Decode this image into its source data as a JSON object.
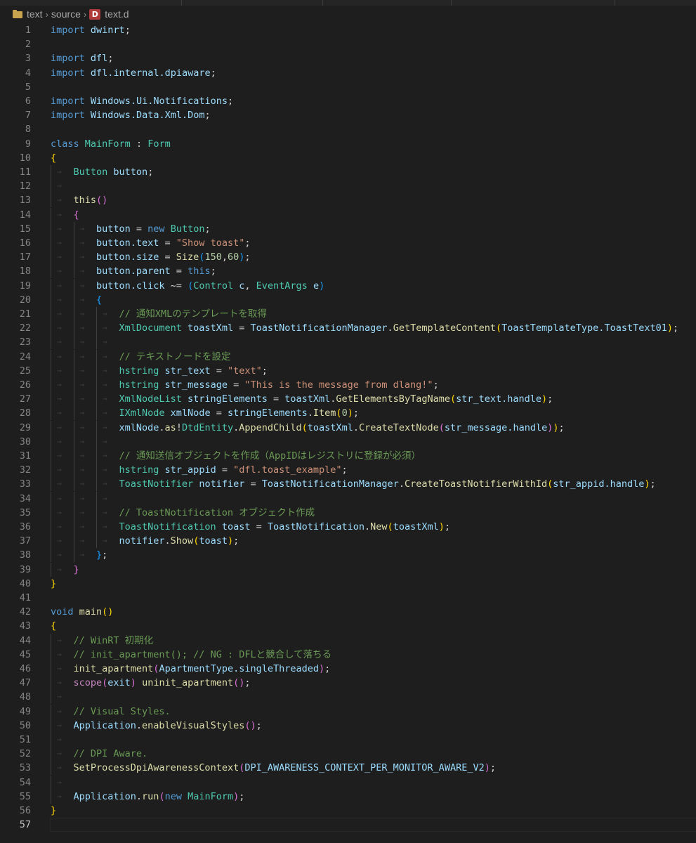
{
  "breadcrumb": {
    "items": [
      "text",
      "source",
      "text.d"
    ],
    "file_icon_letter": "D"
  },
  "editor": {
    "language": "d",
    "active_line": 57,
    "colors": {
      "background": "#1e1e1e",
      "keyword": "#569cd6",
      "control": "#c586c0",
      "type": "#4ec9b0",
      "identifier": "#9cdcfe",
      "function": "#dcdcaa",
      "string": "#ce9178",
      "number": "#b5cea8",
      "comment": "#6a9955",
      "bracket_1": "#ffd700",
      "bracket_2": "#da70d6",
      "bracket_3": "#179fff"
    },
    "lines": [
      {
        "n": "1",
        "indent": 0,
        "t": [
          [
            "kw",
            "import"
          ],
          [
            "pn",
            " "
          ],
          [
            "id",
            "dwinrt"
          ],
          [
            "pn",
            ";"
          ]
        ]
      },
      {
        "n": "2",
        "indent": 0,
        "t": []
      },
      {
        "n": "3",
        "indent": 0,
        "t": [
          [
            "kw",
            "import"
          ],
          [
            "pn",
            " "
          ],
          [
            "id",
            "dfl"
          ],
          [
            "pn",
            ";"
          ]
        ]
      },
      {
        "n": "4",
        "indent": 0,
        "t": [
          [
            "kw",
            "import"
          ],
          [
            "pn",
            " "
          ],
          [
            "id",
            "dfl.internal.dpiaware"
          ],
          [
            "pn",
            ";"
          ]
        ]
      },
      {
        "n": "5",
        "indent": 0,
        "t": []
      },
      {
        "n": "6",
        "indent": 0,
        "t": [
          [
            "kw",
            "import"
          ],
          [
            "pn",
            " "
          ],
          [
            "id",
            "Windows.Ui.Notifications"
          ],
          [
            "pn",
            ";"
          ]
        ]
      },
      {
        "n": "7",
        "indent": 0,
        "t": [
          [
            "kw",
            "import"
          ],
          [
            "pn",
            " "
          ],
          [
            "id",
            "Windows.Data.Xml.Dom"
          ],
          [
            "pn",
            ";"
          ]
        ]
      },
      {
        "n": "8",
        "indent": 0,
        "t": []
      },
      {
        "n": "9",
        "indent": 0,
        "t": [
          [
            "kw",
            "class"
          ],
          [
            "pn",
            " "
          ],
          [
            "ty",
            "MainForm"
          ],
          [
            "pn",
            " : "
          ],
          [
            "ty",
            "Form"
          ]
        ]
      },
      {
        "n": "10",
        "indent": 0,
        "t": [
          [
            "b1",
            "{"
          ]
        ]
      },
      {
        "n": "11",
        "indent": 1,
        "t": [
          [
            "ty",
            "Button"
          ],
          [
            "pn",
            " "
          ],
          [
            "id",
            "button"
          ],
          [
            "pn",
            ";"
          ]
        ]
      },
      {
        "n": "12",
        "indent": 1,
        "t": []
      },
      {
        "n": "13",
        "indent": 1,
        "t": [
          [
            "fn",
            "this"
          ],
          [
            "b2",
            "()"
          ]
        ]
      },
      {
        "n": "14",
        "indent": 1,
        "t": [
          [
            "b2",
            "{"
          ]
        ]
      },
      {
        "n": "15",
        "indent": 2,
        "t": [
          [
            "id",
            "button"
          ],
          [
            "pn",
            " = "
          ],
          [
            "kw",
            "new"
          ],
          [
            "pn",
            " "
          ],
          [
            "ty",
            "Button"
          ],
          [
            "pn",
            ";"
          ]
        ]
      },
      {
        "n": "16",
        "indent": 2,
        "t": [
          [
            "id",
            "button.text"
          ],
          [
            "pn",
            " = "
          ],
          [
            "st",
            "\"Show toast\""
          ],
          [
            "pn",
            ";"
          ]
        ]
      },
      {
        "n": "17",
        "indent": 2,
        "t": [
          [
            "id",
            "button.size"
          ],
          [
            "pn",
            " = "
          ],
          [
            "fn",
            "Size"
          ],
          [
            "b3",
            "("
          ],
          [
            "nm",
            "150"
          ],
          [
            "pn",
            ","
          ],
          [
            "nm",
            "60"
          ],
          [
            "b3",
            ")"
          ],
          [
            "pn",
            ";"
          ]
        ]
      },
      {
        "n": "18",
        "indent": 2,
        "t": [
          [
            "id",
            "button.parent"
          ],
          [
            "pn",
            " = "
          ],
          [
            "kw",
            "this"
          ],
          [
            "pn",
            ";"
          ]
        ]
      },
      {
        "n": "19",
        "indent": 2,
        "t": [
          [
            "id",
            "button.click"
          ],
          [
            "pn",
            " ~= "
          ],
          [
            "b3",
            "("
          ],
          [
            "ty",
            "Control"
          ],
          [
            "pn",
            " "
          ],
          [
            "id",
            "c"
          ],
          [
            "pn",
            ", "
          ],
          [
            "ty",
            "EventArgs"
          ],
          [
            "pn",
            " "
          ],
          [
            "id",
            "e"
          ],
          [
            "b3",
            ")"
          ]
        ]
      },
      {
        "n": "20",
        "indent": 2,
        "t": [
          [
            "b3",
            "{"
          ]
        ]
      },
      {
        "n": "21",
        "indent": 3,
        "t": [
          [
            "cm",
            "// 通知XMLのテンプレートを取得"
          ]
        ]
      },
      {
        "n": "22",
        "indent": 3,
        "t": [
          [
            "ty",
            "XmlDocument"
          ],
          [
            "pn",
            " "
          ],
          [
            "id",
            "toastXml"
          ],
          [
            "pn",
            " = "
          ],
          [
            "id",
            "ToastNotificationManager"
          ],
          [
            "pn",
            "."
          ],
          [
            "fn",
            "GetTemplateContent"
          ],
          [
            "b1",
            "("
          ],
          [
            "id",
            "ToastTemplateType.ToastText01"
          ],
          [
            "b1",
            ")"
          ],
          [
            "pn",
            ";"
          ]
        ]
      },
      {
        "n": "23",
        "indent": 3,
        "t": []
      },
      {
        "n": "24",
        "indent": 3,
        "t": [
          [
            "cm",
            "// テキストノードを設定"
          ]
        ]
      },
      {
        "n": "25",
        "indent": 3,
        "t": [
          [
            "ty",
            "hstring"
          ],
          [
            "pn",
            " "
          ],
          [
            "id",
            "str_text"
          ],
          [
            "pn",
            " = "
          ],
          [
            "st",
            "\"text\""
          ],
          [
            "pn",
            ";"
          ]
        ]
      },
      {
        "n": "26",
        "indent": 3,
        "t": [
          [
            "ty",
            "hstring"
          ],
          [
            "pn",
            " "
          ],
          [
            "id",
            "str_message"
          ],
          [
            "pn",
            " = "
          ],
          [
            "st",
            "\"This is the message from dlang!\""
          ],
          [
            "pn",
            ";"
          ]
        ]
      },
      {
        "n": "27",
        "indent": 3,
        "t": [
          [
            "ty",
            "XmlNodeList"
          ],
          [
            "pn",
            " "
          ],
          [
            "id",
            "stringElements"
          ],
          [
            "pn",
            " = "
          ],
          [
            "id",
            "toastXml"
          ],
          [
            "pn",
            "."
          ],
          [
            "fn",
            "GetElementsByTagName"
          ],
          [
            "b1",
            "("
          ],
          [
            "id",
            "str_text.handle"
          ],
          [
            "b1",
            ")"
          ],
          [
            "pn",
            ";"
          ]
        ]
      },
      {
        "n": "28",
        "indent": 3,
        "t": [
          [
            "ty",
            "IXmlNode"
          ],
          [
            "pn",
            " "
          ],
          [
            "id",
            "xmlNode"
          ],
          [
            "pn",
            " = "
          ],
          [
            "id",
            "stringElements"
          ],
          [
            "pn",
            "."
          ],
          [
            "fn",
            "Item"
          ],
          [
            "b1",
            "("
          ],
          [
            "nm",
            "0"
          ],
          [
            "b1",
            ")"
          ],
          [
            "pn",
            ";"
          ]
        ]
      },
      {
        "n": "29",
        "indent": 3,
        "t": [
          [
            "id",
            "xmlNode"
          ],
          [
            "pn",
            "."
          ],
          [
            "fn",
            "as"
          ],
          [
            "pn",
            "!"
          ],
          [
            "ty",
            "DtdEntity"
          ],
          [
            "pn",
            "."
          ],
          [
            "fn",
            "AppendChild"
          ],
          [
            "b1",
            "("
          ],
          [
            "id",
            "toastXml"
          ],
          [
            "pn",
            "."
          ],
          [
            "fn",
            "CreateTextNode"
          ],
          [
            "b2",
            "("
          ],
          [
            "id",
            "str_message.handle"
          ],
          [
            "b2",
            ")"
          ],
          [
            "b1",
            ")"
          ],
          [
            "pn",
            ";"
          ]
        ]
      },
      {
        "n": "30",
        "indent": 3,
        "t": []
      },
      {
        "n": "31",
        "indent": 3,
        "t": [
          [
            "cm",
            "// 通知送信オブジェクトを作成（AppIDはレジストリに登録が必須）"
          ]
        ]
      },
      {
        "n": "32",
        "indent": 3,
        "t": [
          [
            "ty",
            "hstring"
          ],
          [
            "pn",
            " "
          ],
          [
            "id",
            "str_appid"
          ],
          [
            "pn",
            " = "
          ],
          [
            "st",
            "\"dfl.toast_example\""
          ],
          [
            "pn",
            ";"
          ]
        ]
      },
      {
        "n": "33",
        "indent": 3,
        "t": [
          [
            "ty",
            "ToastNotifier"
          ],
          [
            "pn",
            " "
          ],
          [
            "id",
            "notifier"
          ],
          [
            "pn",
            " = "
          ],
          [
            "id",
            "ToastNotificationManager"
          ],
          [
            "pn",
            "."
          ],
          [
            "fn",
            "CreateToastNotifierWithId"
          ],
          [
            "b1",
            "("
          ],
          [
            "id",
            "str_appid.handle"
          ],
          [
            "b1",
            ")"
          ],
          [
            "pn",
            ";"
          ]
        ]
      },
      {
        "n": "34",
        "indent": 3,
        "t": []
      },
      {
        "n": "35",
        "indent": 3,
        "t": [
          [
            "cm",
            "// ToastNotification オブジェクト作成"
          ]
        ]
      },
      {
        "n": "36",
        "indent": 3,
        "t": [
          [
            "ty",
            "ToastNotification"
          ],
          [
            "pn",
            " "
          ],
          [
            "id",
            "toast"
          ],
          [
            "pn",
            " = "
          ],
          [
            "id",
            "ToastNotification"
          ],
          [
            "pn",
            "."
          ],
          [
            "fn",
            "New"
          ],
          [
            "b1",
            "("
          ],
          [
            "id",
            "toastXml"
          ],
          [
            "b1",
            ")"
          ],
          [
            "pn",
            ";"
          ]
        ]
      },
      {
        "n": "37",
        "indent": 3,
        "t": [
          [
            "id",
            "notifier"
          ],
          [
            "pn",
            "."
          ],
          [
            "fn",
            "Show"
          ],
          [
            "b1",
            "("
          ],
          [
            "id",
            "toast"
          ],
          [
            "b1",
            ")"
          ],
          [
            "pn",
            ";"
          ]
        ]
      },
      {
        "n": "38",
        "indent": 2,
        "t": [
          [
            "b3",
            "}"
          ],
          [
            "pn",
            ";"
          ]
        ]
      },
      {
        "n": "39",
        "indent": 1,
        "t": [
          [
            "b2",
            "}"
          ]
        ]
      },
      {
        "n": "40",
        "indent": 0,
        "t": [
          [
            "b1",
            "}"
          ]
        ]
      },
      {
        "n": "41",
        "indent": 0,
        "t": []
      },
      {
        "n": "42",
        "indent": 0,
        "t": [
          [
            "kw",
            "void"
          ],
          [
            "pn",
            " "
          ],
          [
            "fn",
            "main"
          ],
          [
            "b1",
            "()"
          ]
        ]
      },
      {
        "n": "43",
        "indent": 0,
        "t": [
          [
            "b1",
            "{"
          ]
        ]
      },
      {
        "n": "44",
        "indent": 1,
        "t": [
          [
            "cm",
            "// WinRT 初期化"
          ]
        ]
      },
      {
        "n": "45",
        "indent": 1,
        "t": [
          [
            "cm",
            "// init_apartment(); // NG : DFLと競合して落ちる"
          ]
        ]
      },
      {
        "n": "46",
        "indent": 1,
        "t": [
          [
            "fn",
            "init_apartment"
          ],
          [
            "b2",
            "("
          ],
          [
            "id",
            "ApartmentType.singleThreaded"
          ],
          [
            "b2",
            ")"
          ],
          [
            "pn",
            ";"
          ]
        ]
      },
      {
        "n": "47",
        "indent": 1,
        "t": [
          [
            "cf",
            "scope"
          ],
          [
            "b2",
            "("
          ],
          [
            "id",
            "exit"
          ],
          [
            "b2",
            ")"
          ],
          [
            "pn",
            " "
          ],
          [
            "fn",
            "uninit_apartment"
          ],
          [
            "b2",
            "()"
          ],
          [
            "pn",
            ";"
          ]
        ]
      },
      {
        "n": "48",
        "indent": 1,
        "t": []
      },
      {
        "n": "49",
        "indent": 1,
        "t": [
          [
            "cm",
            "// Visual Styles."
          ]
        ]
      },
      {
        "n": "50",
        "indent": 1,
        "t": [
          [
            "id",
            "Application"
          ],
          [
            "pn",
            "."
          ],
          [
            "fn",
            "enableVisualStyles"
          ],
          [
            "b2",
            "()"
          ],
          [
            "pn",
            ";"
          ]
        ]
      },
      {
        "n": "51",
        "indent": 1,
        "t": []
      },
      {
        "n": "52",
        "indent": 1,
        "t": [
          [
            "cm",
            "// DPI Aware."
          ]
        ]
      },
      {
        "n": "53",
        "indent": 1,
        "t": [
          [
            "fn",
            "SetProcessDpiAwarenessContext"
          ],
          [
            "b2",
            "("
          ],
          [
            "id",
            "DPI_AWARENESS_CONTEXT_PER_MONITOR_AWARE_V2"
          ],
          [
            "b2",
            ")"
          ],
          [
            "pn",
            ";"
          ]
        ]
      },
      {
        "n": "54",
        "indent": 1,
        "t": []
      },
      {
        "n": "55",
        "indent": 1,
        "t": [
          [
            "id",
            "Application"
          ],
          [
            "pn",
            "."
          ],
          [
            "fn",
            "run"
          ],
          [
            "b2",
            "("
          ],
          [
            "kw",
            "new"
          ],
          [
            "pn",
            " "
          ],
          [
            "ty",
            "MainForm"
          ],
          [
            "b2",
            ")"
          ],
          [
            "pn",
            ";"
          ]
        ]
      },
      {
        "n": "56",
        "indent": 0,
        "t": [
          [
            "b1",
            "}"
          ]
        ]
      },
      {
        "n": "57",
        "indent": 0,
        "t": []
      }
    ]
  }
}
